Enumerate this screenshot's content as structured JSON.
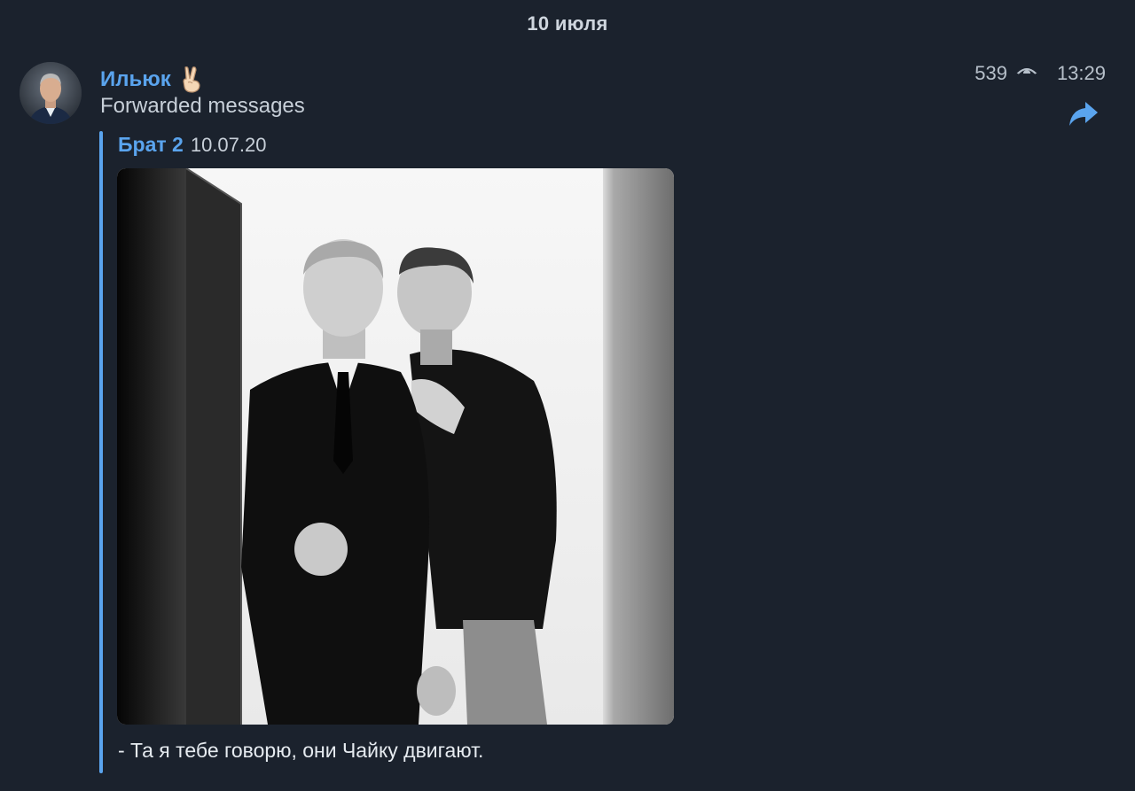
{
  "date_separator": "10 июля",
  "message": {
    "author": "Ильюк",
    "author_emoji": "victory-hand",
    "subtitle": "Forwarded messages",
    "views": "539",
    "time": "13:29",
    "forwarded": {
      "from": "Брат 2",
      "date": "10.07.20",
      "photo": "black-and-white-photo-two-men-in-suits",
      "caption": "- Та я тебе говорю, они Чайку двигают."
    }
  },
  "colors": {
    "background": "#1b222d",
    "accent": "#5aa4ee",
    "text": "#e6ebf0",
    "muted": "#b7c0ca"
  },
  "icons": {
    "views": "eye-icon",
    "share": "share-arrow-icon"
  }
}
